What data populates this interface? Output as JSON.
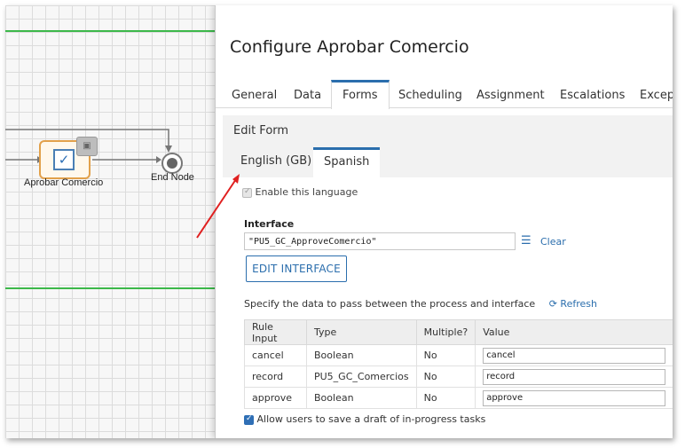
{
  "canvas": {
    "task_label": "Aprobar Comercio",
    "end_label": "End Node"
  },
  "dialog": {
    "title": "Configure Aprobar Comercio",
    "tabs": [
      {
        "label": "General"
      },
      {
        "label": "Data"
      },
      {
        "label": "Forms",
        "active": true
      },
      {
        "label": "Scheduling"
      },
      {
        "label": "Assignment"
      },
      {
        "label": "Escalations"
      },
      {
        "label": "Excepti"
      }
    ],
    "section_title": "Edit Form",
    "language_tabs": [
      {
        "label": "English (GB)"
      },
      {
        "label": "Spanish",
        "active": true
      }
    ],
    "enable_language": "Enable this language",
    "interface_label": "Interface",
    "interface_value": "\"PU5_GC_ApproveComercio\"",
    "clear_label": "Clear",
    "edit_button": "EDIT INTERFACE",
    "spec_text": "Specify the data to pass between the process and interface",
    "refresh_label": "Refresh",
    "table": {
      "headers": [
        "Rule Input",
        "Type",
        "Multiple?",
        "Value"
      ],
      "rows": [
        {
          "input": "cancel",
          "type": "Boolean",
          "multiple": "No",
          "value": "cancel"
        },
        {
          "input": "record",
          "type": "PU5_GC_Comercios",
          "multiple": "No",
          "value": "record"
        },
        {
          "input": "approve",
          "type": "Boolean",
          "multiple": "No",
          "value": "approve"
        }
      ]
    },
    "draft_label": "Allow users to save a draft of in-progress tasks"
  },
  "colors": {
    "accent": "#2b6ead",
    "swimlane": "#3cb84a",
    "annotation_arrow": "#e02020",
    "task_border": "#e2a14b"
  }
}
